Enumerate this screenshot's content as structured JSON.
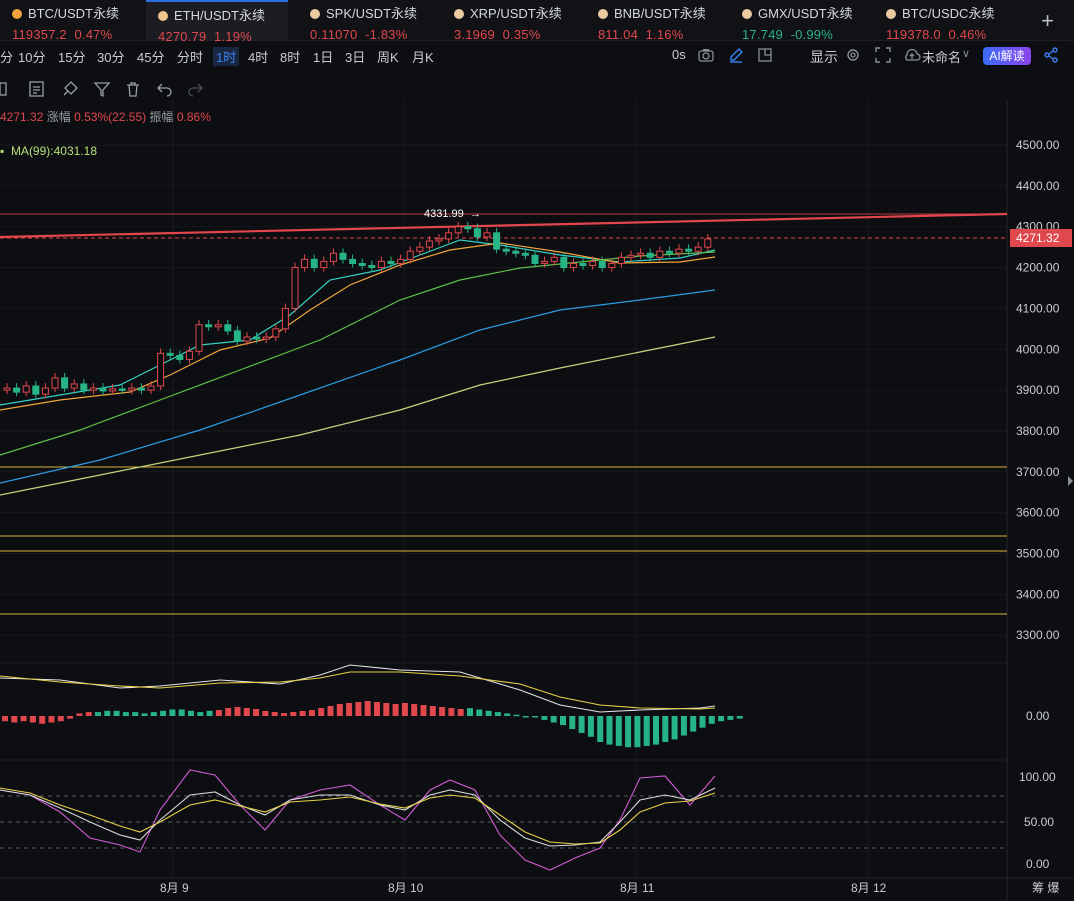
{
  "tickers": [
    {
      "symbol": "BTC/USDT永续",
      "price": "119357.2",
      "change": "0.47%",
      "dir": "up",
      "coin_color": "#f2a33a"
    },
    {
      "symbol": "ETH/USDT永续",
      "price": "4270.79",
      "change": "1.19%",
      "dir": "up",
      "coin_color": "#e8c9a0"
    },
    {
      "symbol": "SPK/USDT永续",
      "price": "0.11070",
      "change": "-1.83%",
      "dir": "up",
      "coin_color": "#e8c9a0"
    },
    {
      "symbol": "XRP/USDT永续",
      "price": "3.1969",
      "change": "0.35%",
      "dir": "up",
      "coin_color": "#e8c9a0"
    },
    {
      "symbol": "BNB/USDT永续",
      "price": "811.04",
      "change": "1.16%",
      "dir": "up",
      "coin_color": "#e8c9a0"
    },
    {
      "symbol": "GMX/USDT永续",
      "price": "17.749",
      "change": "-0.99%",
      "dir": "down",
      "coin_color": "#e8c9a0"
    },
    {
      "symbol": "BTC/USDC永续",
      "price": "119378.0",
      "change": "0.46%",
      "dir": "up",
      "coin_color": "#e8c9a0"
    }
  ],
  "toolbar": {
    "timeframes": [
      "分",
      "10分",
      "15分",
      "30分",
      "45分",
      "分时",
      "1时",
      "4时",
      "8时",
      "1日",
      "3日",
      "周K",
      "月K"
    ],
    "selected_timeframe": "1时",
    "countdown": "0s",
    "display_label": "显示",
    "layout_name": "未命名",
    "ai_button": "AI解读"
  },
  "info": {
    "price": "4271.32",
    "change_label": "涨幅",
    "change_value": "0.53%(22.55)",
    "amp_label": "振幅",
    "amp_value": "0.86%"
  },
  "ma_label": "MA(99):4031.18",
  "price_axis": [
    "4500.00",
    "4400.00",
    "4300.00",
    "4200.00",
    "4100.00",
    "4000.00",
    "3900.00",
    "3800.00",
    "3700.00",
    "3600.00",
    "3500.00",
    "3400.00",
    "3300.00"
  ],
  "current_price_tag": "4271.32",
  "high_marker": "4331.99",
  "macd_axis": [
    "0.00"
  ],
  "kdj_axis": [
    "100.00",
    "50.00",
    "0.00"
  ],
  "date_labels": [
    "8月 9",
    "8月 10",
    "8月 11",
    "8月 12"
  ],
  "corner_label": "筹 爆",
  "colors": {
    "up": "#e0484e",
    "down": "#27b486",
    "accent": "#3b82f6"
  }
}
